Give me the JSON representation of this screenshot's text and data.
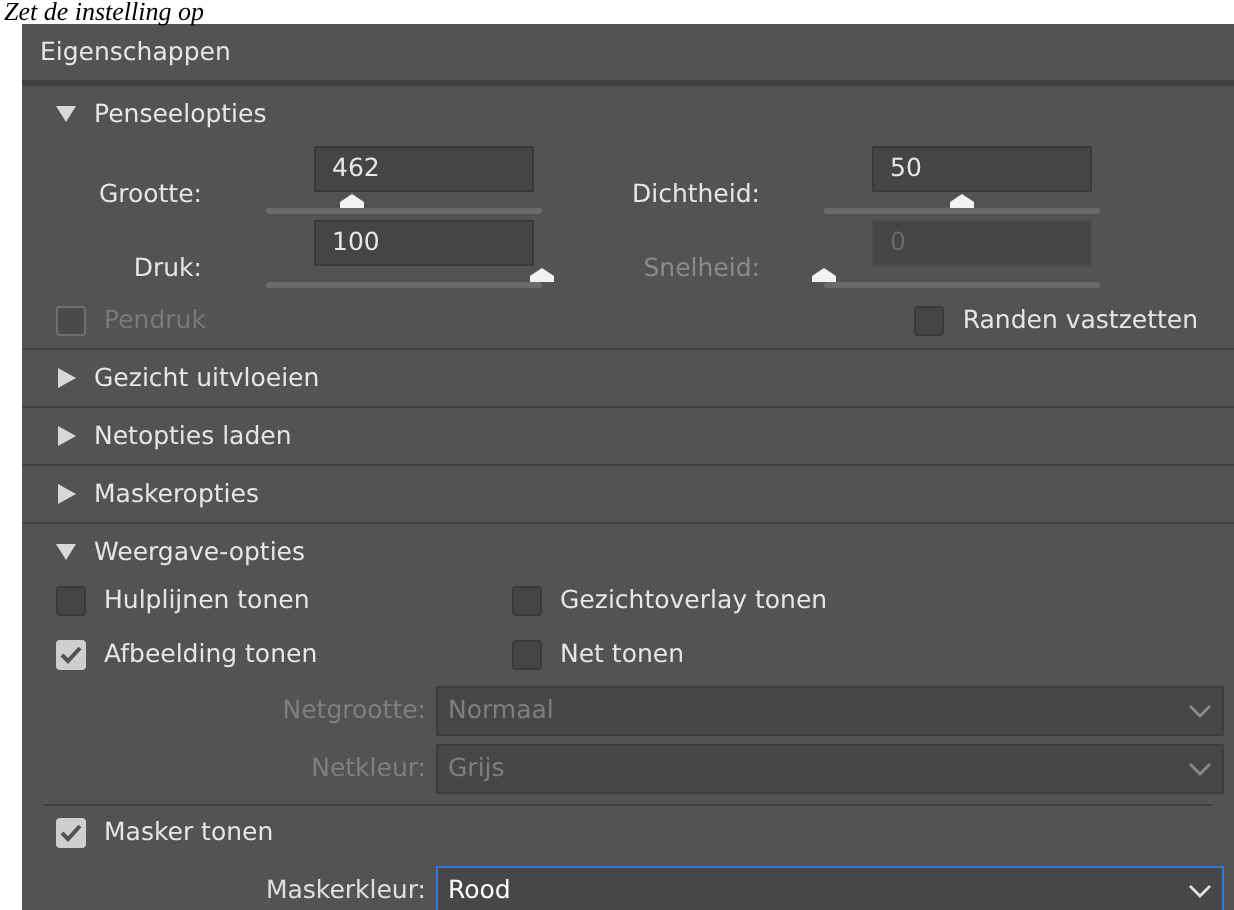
{
  "caption": "Zet de instelling op",
  "panel": {
    "title": "Eigenschappen",
    "sections": [
      {
        "kind": "brush",
        "label": "Penseelopties",
        "expanded": true,
        "sliders": [
          {
            "label": "Grootte:",
            "value": "462",
            "level": 0.31,
            "disabled": false
          },
          {
            "label": "Dichtheid:",
            "value": "50",
            "level": 0.5,
            "disabled": false
          },
          {
            "label": "Druk:",
            "value": "100",
            "level": 1,
            "disabled": false
          },
          {
            "label": "Snelheid:",
            "value": "0",
            "level": 0,
            "disabled": true
          }
        ],
        "options": [
          {
            "label": "Pendruk",
            "checked": false,
            "disabled": true
          },
          {
            "label": "Randen vastzetten",
            "checked": false,
            "disabled": false
          }
        ]
      },
      {
        "kind": "plain",
        "label": "Gezicht uitvloeien",
        "expanded": false
      },
      {
        "kind": "plain",
        "label": "Netopties laden",
        "expanded": false
      },
      {
        "kind": "plain",
        "label": "Maskeropties",
        "expanded": false
      },
      {
        "kind": "view",
        "label": "Weergave-opties",
        "expanded": true,
        "checkboxes": [
          {
            "label": "Hulplijnen tonen",
            "checked": false
          },
          {
            "label": "Gezichtoverlay tonen",
            "checked": false
          },
          {
            "label": "Afbeelding tonen",
            "checked": true
          },
          {
            "label": "Net tonen",
            "checked": false
          }
        ],
        "dropdowns": [
          {
            "label": "Netgrootte:",
            "value": "Normaal",
            "disabled": true,
            "focused": false
          },
          {
            "label": "Netkleur:",
            "value": "Grijs",
            "disabled": true,
            "focused": false
          }
        ],
        "mask_checkbox": {
          "label": "Masker tonen",
          "checked": true
        },
        "mask_dropdown": {
          "label": "Maskerkleur:",
          "value": "Rood",
          "disabled": false,
          "focused": true
        }
      }
    ]
  }
}
